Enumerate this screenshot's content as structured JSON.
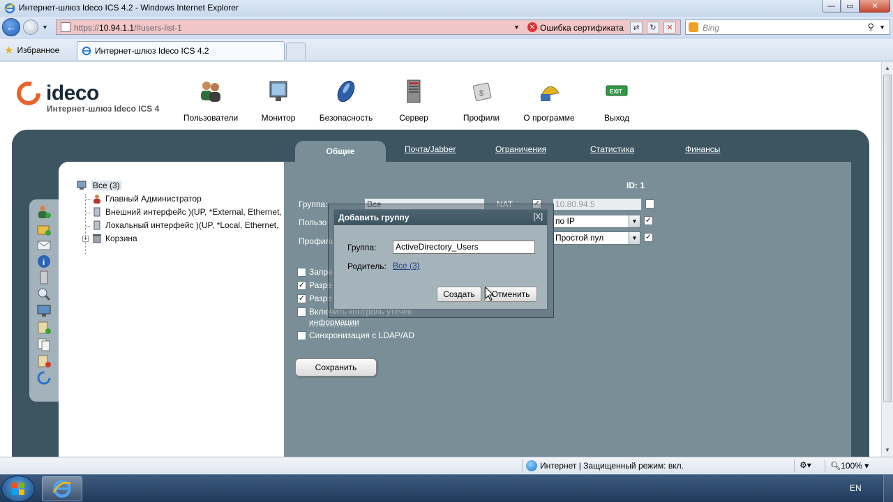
{
  "window": {
    "title": "Интернет-шлюз Ideco ICS 4.2 - Windows Internet Explorer",
    "controls": {
      "minimize": "—",
      "maximize": "▭",
      "close": "✕"
    }
  },
  "addressbar": {
    "url_prefix": "https://",
    "url_host": "10.94.1.1",
    "url_path": "/#users-list-1",
    "cert_error": "Ошибка сертификата",
    "search_placeholder": "Bing"
  },
  "favorites": {
    "label": "Избранное",
    "tab_title": "Интернет-шлюз Ideco ICS 4.2"
  },
  "logo": {
    "name": "ideco",
    "subtitle": "Интернет-шлюз Ideco ICS 4"
  },
  "topnav": [
    {
      "label": "Пользователи",
      "icon": "users-icon"
    },
    {
      "label": "Монитор",
      "icon": "monitor-icon"
    },
    {
      "label": "Безопасность",
      "icon": "shield-icon"
    },
    {
      "label": "Сервер",
      "icon": "server-icon"
    },
    {
      "label": "Профили",
      "icon": "profiles-icon"
    },
    {
      "label": "О программе",
      "icon": "about-icon"
    },
    {
      "label": "Выход",
      "icon": "exit-icon"
    }
  ],
  "subtabs": {
    "active": "Общие",
    "items": [
      "Почта/Jabber",
      "Ограничения",
      "Статистика",
      "Финансы"
    ]
  },
  "tree": {
    "root": "Все (3)",
    "children": [
      "Главный Администратор",
      "Внешний интерфейс )(UP, *External, Ethernet,",
      "Локальный интерфейс )(UP, *Local, Ethernet,",
      "Корзина"
    ]
  },
  "form": {
    "id_label": "ID: 1",
    "group_label": "Группа:",
    "group_value": "Все",
    "nat_label": "NAT",
    "ip_value": "10.80.94.5",
    "user_label": "Пользо",
    "auth_select": "по IP",
    "profile_label": "Профиль",
    "pool_select": "Простой пул",
    "checkboxes": [
      {
        "label": "Запре",
        "checked": false
      },
      {
        "label": "Разре",
        "checked": true
      },
      {
        "label": "Разре",
        "checked": true
      },
      {
        "label": "Включить контроль утечек",
        "label2": "информации",
        "checked": false
      },
      {
        "label": "Синхронизация с LDAP/AD",
        "checked": false
      }
    ],
    "save_button": "Сохранить"
  },
  "dialog": {
    "title": "Добавить группу",
    "close": "[X]",
    "group_label": "Группа:",
    "group_value": "ActiveDirectory_Users",
    "parent_label": "Родитель:",
    "parent_value": "Все (3)",
    "create_button": "Создать",
    "cancel_button": "Отменить"
  },
  "statusbar": {
    "zone": "Интернет | Защищенный режим: вкл.",
    "zoom": "100%"
  },
  "taskbar": {
    "lang": "EN"
  },
  "colors": {
    "shell": "#3d5561",
    "content": "#7a8e97",
    "dialog_header": "#3d5561",
    "addressbar_error": "#f1c6c6"
  }
}
